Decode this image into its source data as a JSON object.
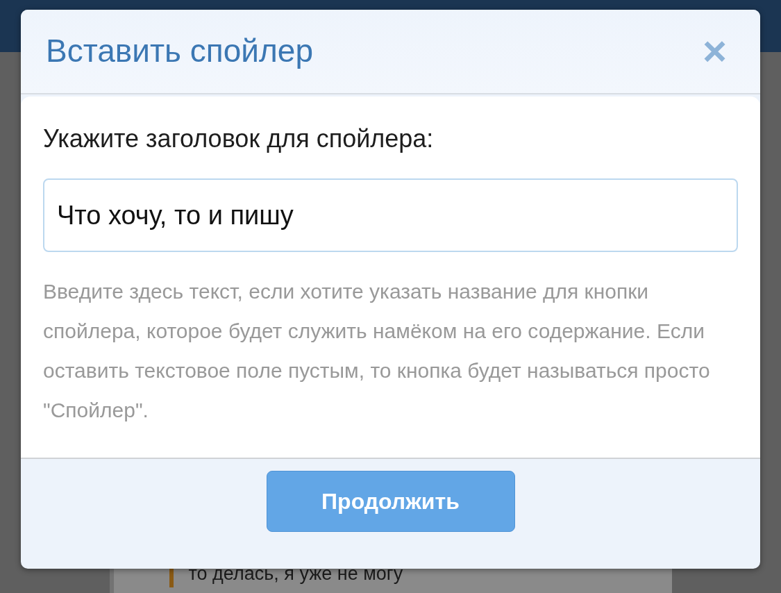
{
  "background_post": {
    "text": "то делась, я уже не могу"
  },
  "dialog": {
    "title": "Вставить спойлер",
    "close": "×",
    "label": "Укажите заголовок для спойлера:",
    "field": {
      "value": "Что хочу, то и пишу"
    },
    "help": "Введите здесь текст, если хотите указать название для кнопки спойлера, которое будет служить намёком на его содержание. Если оставить текстовое поле пустым, то кнопка будет называться просто \"Спойлер\".",
    "buttons": [
      "Продолжить"
    ]
  }
}
